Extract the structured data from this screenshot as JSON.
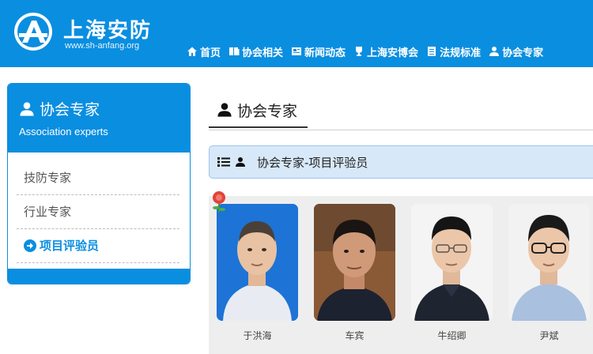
{
  "header": {
    "logo_title": "上海安防",
    "logo_sub": "www.sh-anfang.org",
    "nav": [
      {
        "label": "首页",
        "icon": "home-icon"
      },
      {
        "label": "协会相关",
        "icon": "book-icon"
      },
      {
        "label": "新闻动态",
        "icon": "newspaper-icon"
      },
      {
        "label": "上海安博会",
        "icon": "trophy-icon"
      },
      {
        "label": "法规标准",
        "icon": "document-icon"
      },
      {
        "label": "协会专家",
        "icon": "user-icon"
      }
    ]
  },
  "sidebar": {
    "title": "协会专家",
    "subtitle": "Association experts",
    "items": [
      {
        "label": "技防专家"
      },
      {
        "label": "行业专家"
      },
      {
        "label": "项目评验员"
      }
    ]
  },
  "main": {
    "title": "协会专家",
    "breadcrumb": "协会专家-项目评验员",
    "experts": [
      {
        "name": "于洪海",
        "bg": "#1d73d6"
      },
      {
        "name": "车宾",
        "bg": "#8a5a36"
      },
      {
        "name": "牛绍卿",
        "bg": "#f4f4f4"
      },
      {
        "name": "尹斌",
        "bg": "#f2f2f2"
      }
    ]
  },
  "colors": {
    "accent": "#0a8ee0",
    "crumb_bg": "#d7e8f9"
  }
}
